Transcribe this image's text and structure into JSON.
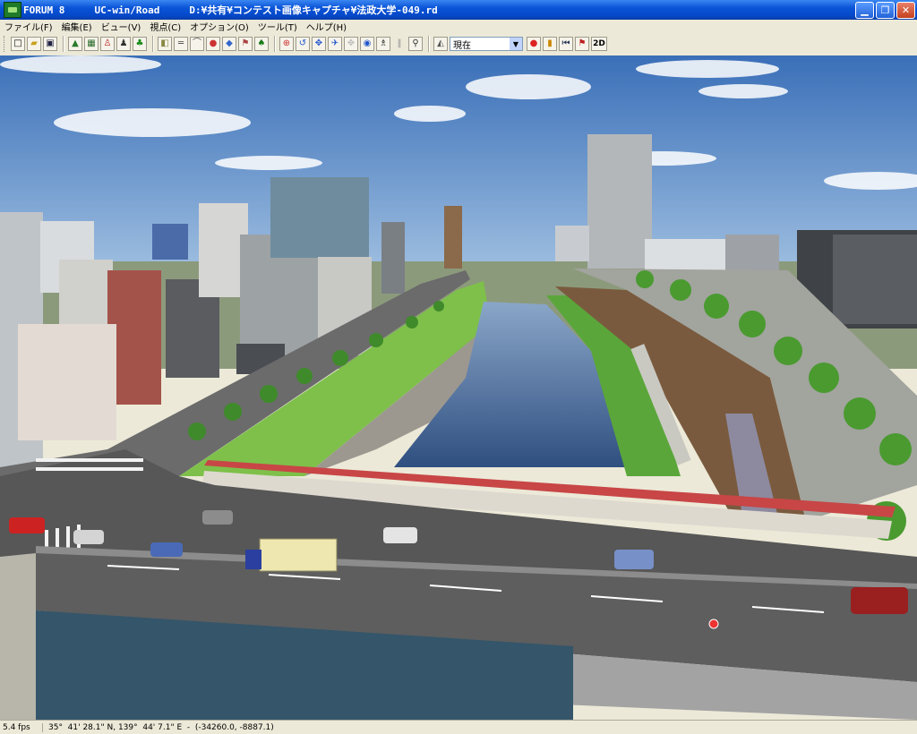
{
  "window": {
    "app_name": "FORUM 8",
    "title": "FORUM 8     UC-win/Road     D:¥共有¥コンテスト画像キャプチャ¥法政大学-049.rd",
    "controls": [
      "minimize-icon",
      "maximize-icon",
      "close-icon"
    ]
  },
  "menu": {
    "items": [
      "ファイル(F)",
      "編集(E)",
      "ビュー(V)",
      "視点(C)",
      "オプション(O)",
      "ツール(T)",
      "ヘルプ(H)"
    ]
  },
  "toolbar": {
    "view_mode_selected": "現在",
    "label_2d": "2D",
    "group1": [
      "new-file-icon",
      "open-folder-icon",
      "save-icon"
    ],
    "group2": [
      "terrain-icon",
      "grid-icon",
      "person-icon",
      "walk-icon",
      "tree-icon"
    ],
    "group3": [
      "model-icon",
      "road-icon",
      "bridge-icon",
      "car-icon",
      "traffic-icon",
      "sign-icon",
      "forest-icon"
    ],
    "group4": [
      "navigate-icon",
      "rotate-icon",
      "move-icon",
      "fly-icon",
      "disabled-icon",
      "globe-icon",
      "pedestrian-icon",
      "pause-icon",
      "bike-icon"
    ],
    "group5": [
      "camera-icon",
      "record-icon",
      "play-icon",
      "rewind-icon",
      "flag-icon"
    ]
  },
  "status": {
    "fps": "5.4 fps",
    "coords": "35°  41' 28.1\" N, 139°  44' 7.1\" E  -  (-34260.0, -8887.1)"
  },
  "scene": {
    "sky_top": "#3a6fb8",
    "sky_bottom": "#a9c9e4",
    "water": "#4a6fa0",
    "grass": "#7ec04a",
    "road": "#5a5a5a",
    "railway_frame": "#c84040",
    "truck_box": "#efe7b0"
  }
}
